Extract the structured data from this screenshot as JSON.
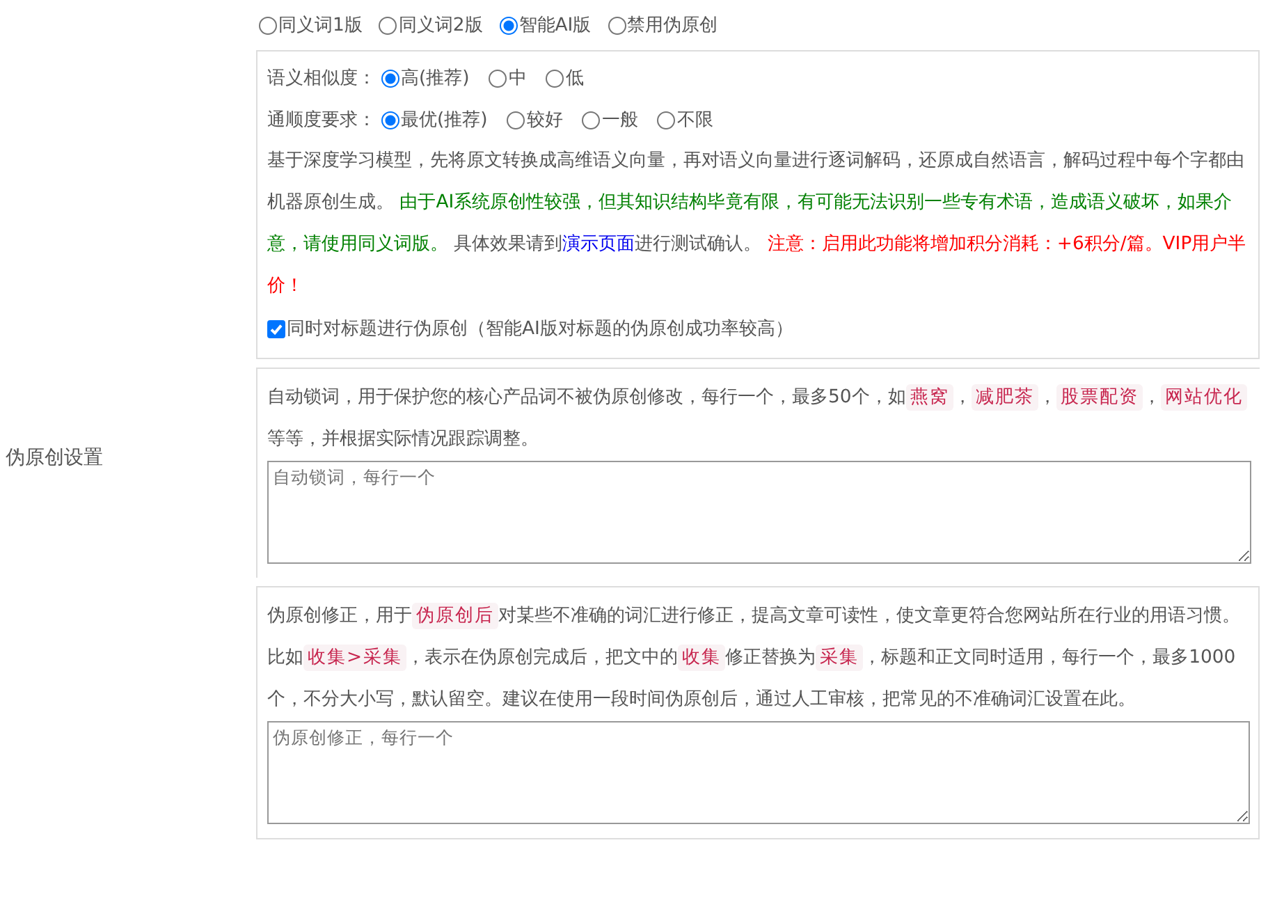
{
  "sidebar_label": "伪原创设置",
  "mode_options": [
    {
      "label": "同义词1版",
      "selected": false
    },
    {
      "label": "同义词2版",
      "selected": false
    },
    {
      "label": "智能AI版",
      "selected": true
    },
    {
      "label": "禁用伪原创",
      "selected": false
    }
  ],
  "similarity": {
    "label": "语义相似度：",
    "options": [
      {
        "label": "高(推荐)",
        "selected": true
      },
      {
        "label": "中",
        "selected": false
      },
      {
        "label": "低",
        "selected": false
      }
    ]
  },
  "fluency": {
    "label": "通顺度要求：",
    "options": [
      {
        "label": "最优(推荐)",
        "selected": true
      },
      {
        "label": "较好",
        "selected": false
      },
      {
        "label": "一般",
        "selected": false
      },
      {
        "label": "不限",
        "selected": false
      }
    ]
  },
  "ai_description": [
    {
      "kind": "plain",
      "text": "基于深度学习模型，先将原文转换成高维语义向量，再对语义向量进行逐词解码，还原成自然语言，解码过程中每个字都由机器原创生成。 "
    },
    {
      "kind": "notice",
      "text": "由于AI系统原创性较强，但其知识结构毕竟有限，有可能无法识别一些专有术语，造成语义破坏，如果介意，请使用同义词版。"
    },
    {
      "kind": "plain",
      "text": " 具体效果请到"
    },
    {
      "kind": "link",
      "text": "演示页面"
    },
    {
      "kind": "plain",
      "text": "进行测试确认。 "
    },
    {
      "kind": "warning",
      "text": "注意：启用此功能将增加积分消耗：+6积分/篇。VIP用户半价！"
    }
  ],
  "title_checkbox": {
    "label": "同时对标题进行伪原创（智能AI版对标题的伪原创成功率较高）",
    "checked": true
  },
  "auto_lock": {
    "description": [
      {
        "kind": "plain",
        "text": "自动锁词，用于保护您的核心产品词不被伪原创修改，每行一个，最多50个，如"
      },
      {
        "kind": "keyword",
        "text": "燕窝"
      },
      {
        "kind": "plain",
        "text": "，"
      },
      {
        "kind": "keyword",
        "text": "减肥茶"
      },
      {
        "kind": "plain",
        "text": "，"
      },
      {
        "kind": "keyword",
        "text": "股票配资"
      },
      {
        "kind": "plain",
        "text": "，"
      },
      {
        "kind": "keyword",
        "text": "网站优化"
      },
      {
        "kind": "plain",
        "text": " 等等，并根据实际情况跟踪调整。"
      }
    ],
    "placeholder": "自动锁词，每行一个"
  },
  "correction": {
    "description": [
      {
        "kind": "plain",
        "text": "伪原创修正，用于"
      },
      {
        "kind": "keyword",
        "text": "伪原创后"
      },
      {
        "kind": "plain",
        "text": "对某些不准确的词汇进行修正，提高文章可读性，使文章更符合您网站所在行业的用语习惯。比如"
      },
      {
        "kind": "keyword",
        "text": "收集>采集"
      },
      {
        "kind": "plain",
        "text": "，表示在伪原创完成后，把文中的"
      },
      {
        "kind": "keyword",
        "text": "收集"
      },
      {
        "kind": "plain",
        "text": "修正替换为"
      },
      {
        "kind": "keyword",
        "text": "采集"
      },
      {
        "kind": "plain",
        "text": "，标题和正文同时适用，每行一个，最多1000个，不分大小写，默认留空。建议在使用一段时间伪原创后，通过人工审核，把常见的不准确词汇设置在此。"
      }
    ],
    "placeholder": "伪原创修正，每行一个"
  }
}
